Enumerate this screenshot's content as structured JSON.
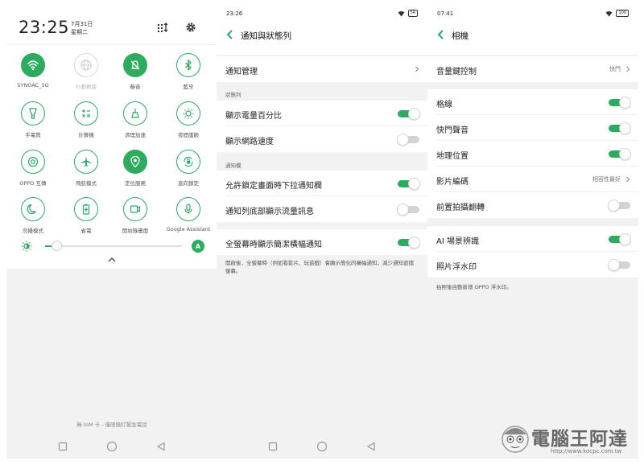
{
  "quick_settings": {
    "time": "23:25",
    "date": "7月31日",
    "weekday": "星期二",
    "tiles": [
      {
        "label": "SYNOAC_5G",
        "state": "on",
        "icon": "wifi-icon"
      },
      {
        "label": "行動數據",
        "state": "dim",
        "icon": "globe-icon"
      },
      {
        "label": "靜音",
        "state": "on",
        "icon": "bell-mute-icon"
      },
      {
        "label": "藍牙",
        "state": "off",
        "icon": "bluetooth-icon"
      },
      {
        "label": "手電筒",
        "state": "off",
        "icon": "flashlight-icon"
      },
      {
        "label": "計算機",
        "state": "off",
        "icon": "calculator-icon"
      },
      {
        "label": "清理加速",
        "state": "off",
        "icon": "broom-icon"
      },
      {
        "label": "夜間護眼",
        "state": "off",
        "icon": "sun-eye-icon"
      },
      {
        "label": "OPPO 互傳",
        "state": "off",
        "icon": "share-icon"
      },
      {
        "label": "飛航模式",
        "state": "off",
        "icon": "airplane-icon"
      },
      {
        "label": "定位服務",
        "state": "on",
        "icon": "location-icon"
      },
      {
        "label": "直向鎖定",
        "state": "off",
        "icon": "rotation-lock-icon"
      },
      {
        "label": "勿擾模式",
        "state": "off",
        "icon": "moon-icon"
      },
      {
        "label": "省電",
        "state": "off",
        "icon": "battery-save-icon"
      },
      {
        "label": "開始錄畫面",
        "state": "off",
        "icon": "screen-record-icon"
      },
      {
        "label": "Google Assistant",
        "state": "off",
        "icon": "mic-icon"
      }
    ],
    "brightness_level": 0.05,
    "auto_brightness_label": "A",
    "sim_text": "無 SIM 卡 - 僅限撥打緊急電話"
  },
  "notification_screen": {
    "status_time": "23:26",
    "battery": "54",
    "title": "通知與狀態列",
    "rows": {
      "manage": "通知管理",
      "section_statusbar": "狀態列",
      "battery_percent": "顯示電量百分比",
      "network_speed": "顯示網路速度",
      "section_notification": "通知欄",
      "lock_pulldown": "允許鎖定畫面時下拉通知欄",
      "traffic_info": "通知列底部顯示流量訊息",
      "fullscreen_banner": "全螢幕時顯示簡潔橫幅通知"
    },
    "toggles": {
      "battery_percent": true,
      "network_speed": false,
      "lock_pulldown": true,
      "traffic_info": false,
      "fullscreen_banner": true
    },
    "fullscreen_desc": "開啟後，全螢幕時（例如看影片、玩遊戲）會顯示簡化的橫幅通知，減少通知遮擋螢幕。"
  },
  "camera_screen": {
    "status_time": "07:41",
    "battery": "100",
    "title": "相機",
    "rows": {
      "volume_key": "音量鍵控制",
      "volume_key_value": "快門",
      "grid": "格線",
      "shutter_sound": "快門聲音",
      "location": "地理位置",
      "video_codec": "影片編碼",
      "video_codec_value": "相容性最好",
      "front_mirror": "前置拍攝翻轉",
      "ai_scene": "AI 場景辨識",
      "watermark": "照片浮水印"
    },
    "toggles": {
      "grid": true,
      "shutter_sound": true,
      "location": true,
      "front_mirror": false,
      "ai_scene": true,
      "watermark": false
    },
    "watermark_desc": "拍照後自動新增 OPPO 浮水印。"
  },
  "site_watermark": {
    "text": "電腦王阿達",
    "url": "http://www.kocpc.com.tw"
  }
}
